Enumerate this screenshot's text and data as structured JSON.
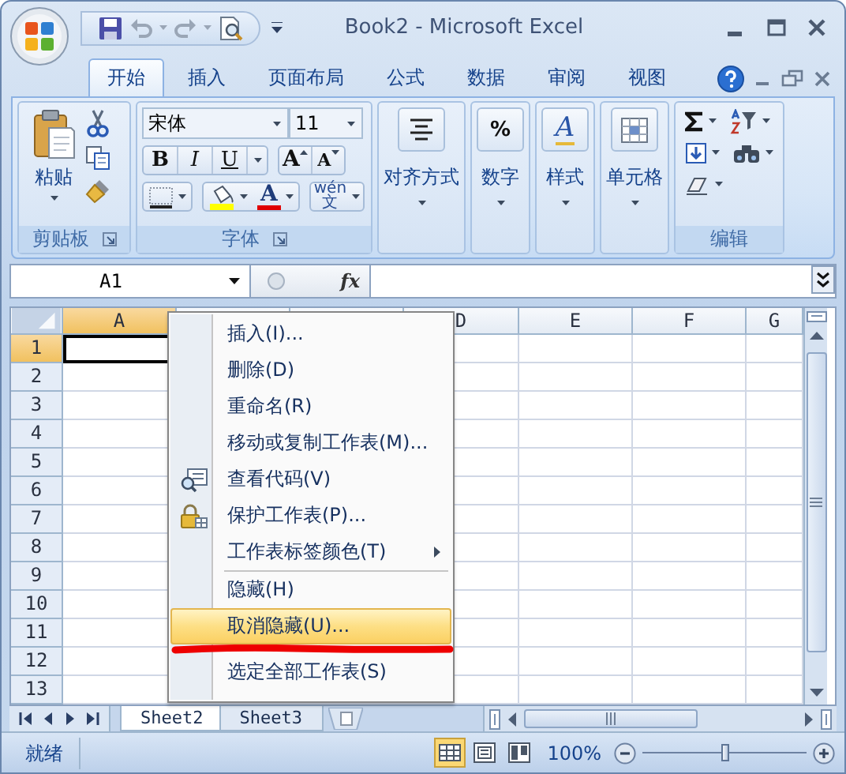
{
  "window": {
    "title": "Book2 - Microsoft Excel"
  },
  "ribbon_tabs": [
    {
      "label": "开始",
      "selected": true
    },
    {
      "label": "插入",
      "selected": false
    },
    {
      "label": "页面布局",
      "selected": false
    },
    {
      "label": "公式",
      "selected": false
    },
    {
      "label": "数据",
      "selected": false
    },
    {
      "label": "审阅",
      "selected": false
    },
    {
      "label": "视图",
      "selected": false
    }
  ],
  "ribbon_groups": [
    {
      "kind": "clipboard",
      "label": "剪贴板",
      "paste_label": "粘贴"
    },
    {
      "kind": "font",
      "label": "字体",
      "font_name": "宋体",
      "font_size": "11",
      "style_buttons": [
        {
          "kind": "bold",
          "glyph": "B"
        },
        {
          "kind": "italic",
          "glyph": "I"
        },
        {
          "kind": "underline",
          "glyph": "U"
        }
      ],
      "size_buttons": [
        {
          "kind": "grow",
          "glyph": "A"
        },
        {
          "kind": "shrink",
          "glyph": "A"
        }
      ],
      "font_color_glyph": "A",
      "phonetic_ruby": "wén",
      "phonetic_glyph": "文"
    },
    {
      "kind": "alignment",
      "label": "对齐方式"
    },
    {
      "kind": "number",
      "label": "数字",
      "glyph": "%"
    },
    {
      "kind": "styles",
      "label": "样式",
      "glyph": "A"
    },
    {
      "kind": "cells",
      "label": "单元格"
    },
    {
      "kind": "editing",
      "label": "编辑"
    }
  ],
  "formula_bar": {
    "name_box": "A1",
    "function_label": "fx"
  },
  "grid": {
    "columns": [
      {
        "label": "A",
        "selected": true
      },
      {
        "selected": false
      },
      {
        "selected": false
      },
      {
        "label": "D",
        "selected": false
      },
      {
        "label": "E",
        "selected": false
      },
      {
        "label": "F",
        "selected": false
      },
      {
        "label": "G",
        "selected": false
      }
    ],
    "rows": [
      {
        "label": "1",
        "selected": true
      },
      {
        "label": "2",
        "selected": false
      },
      {
        "label": "3",
        "selected": false
      },
      {
        "label": "4",
        "selected": false
      },
      {
        "label": "5",
        "selected": false
      },
      {
        "label": "6",
        "selected": false
      },
      {
        "label": "7",
        "selected": false
      },
      {
        "label": "8",
        "selected": false
      },
      {
        "label": "9",
        "selected": false
      },
      {
        "label": "10",
        "selected": false
      },
      {
        "label": "11",
        "selected": false
      },
      {
        "label": "12",
        "selected": false
      },
      {
        "label": "13",
        "selected": false
      }
    ]
  },
  "context_menu": {
    "items": [
      {
        "label": "插入(I)...",
        "kind": "plain",
        "separator_before": false,
        "selected": false
      },
      {
        "label": "删除(D)",
        "kind": "plain",
        "separator_before": false,
        "selected": false
      },
      {
        "label": "重命名(R)",
        "kind": "plain",
        "separator_before": false,
        "selected": false
      },
      {
        "label": "移动或复制工作表(M)...",
        "kind": "plain",
        "separator_before": false,
        "selected": false
      },
      {
        "label": "查看代码(V)",
        "kind": "code",
        "separator_before": false,
        "selected": false
      },
      {
        "label": "保护工作表(P)...",
        "kind": "lock",
        "separator_before": false,
        "selected": false
      },
      {
        "label": "工作表标签颜色(T)",
        "kind": "submenu",
        "separator_before": false,
        "selected": false
      },
      {
        "label": "隐藏(H)",
        "kind": "plain",
        "separator_before": true,
        "selected": false
      },
      {
        "label": "取消隐藏(U)...",
        "kind": "plain",
        "separator_before": false,
        "selected": true
      },
      {
        "label": "选定全部工作表(S)",
        "kind": "plain",
        "separator_before": false,
        "selected": false
      }
    ]
  },
  "sheet_tabs": [
    {
      "label": "Sheet2",
      "selected": true
    },
    {
      "label": "Sheet3",
      "selected": false
    }
  ],
  "status_bar": {
    "status": "就绪",
    "views": [
      {
        "kind": "normal",
        "selected": true
      },
      {
        "kind": "layout",
        "selected": false
      },
      {
        "kind": "pagebreak",
        "selected": false
      }
    ],
    "zoom": "100%",
    "zoom_slider": {
      "level": 0.5
    }
  }
}
